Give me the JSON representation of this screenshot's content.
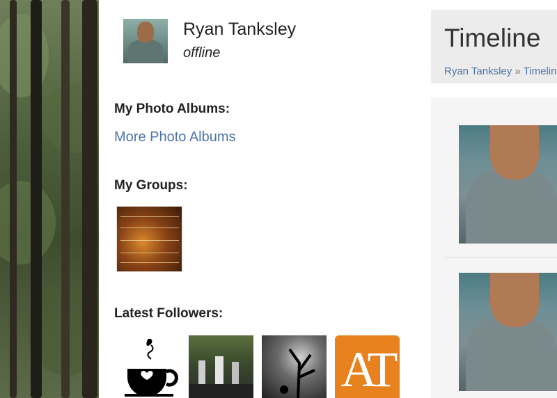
{
  "profile": {
    "name": "Ryan Tanksley",
    "status": "offline"
  },
  "albums": {
    "title": "My Photo Albums:",
    "more_link": "More Photo Albums"
  },
  "groups": {
    "title": "My Groups:"
  },
  "followers": {
    "title": "Latest Followers:"
  },
  "timeline": {
    "title": "Timeline",
    "breadcrumb_user": "Ryan Tanksley",
    "breadcrumb_sep": " » ",
    "breadcrumb_current": "Timeline"
  },
  "colors": {
    "link": "#4d74a8",
    "follower_logo": "#e8821e"
  },
  "icons": {
    "follower_logo_text": "AT"
  }
}
